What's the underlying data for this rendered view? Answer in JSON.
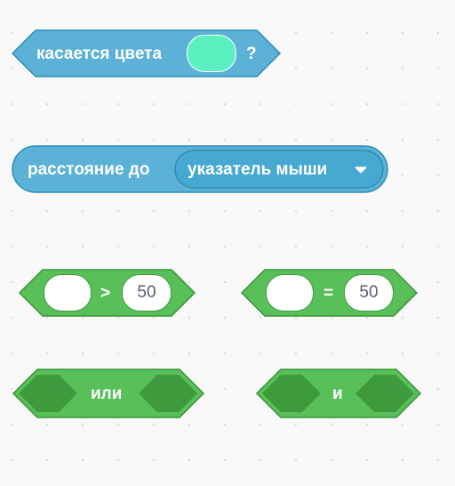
{
  "colors": {
    "sensing": "#5cb1d6",
    "sensing_border": "#2e8eb8",
    "sensing_dark": "#47a8d1",
    "operators": "#59c059",
    "operators_border": "#389438",
    "operators_dark": "#3d9a3d",
    "swatch": "#5bf0c0"
  },
  "touching_color": {
    "label": "касается цвета",
    "suffix": "?"
  },
  "distance_to": {
    "label": "расстояние до",
    "dropdown_value": "указатель мыши"
  },
  "greater_than": {
    "operator": ">",
    "right_value": "50"
  },
  "equals": {
    "operator": "=",
    "right_value": "50"
  },
  "or_block": {
    "label": "или"
  },
  "and_block": {
    "label": "и"
  }
}
